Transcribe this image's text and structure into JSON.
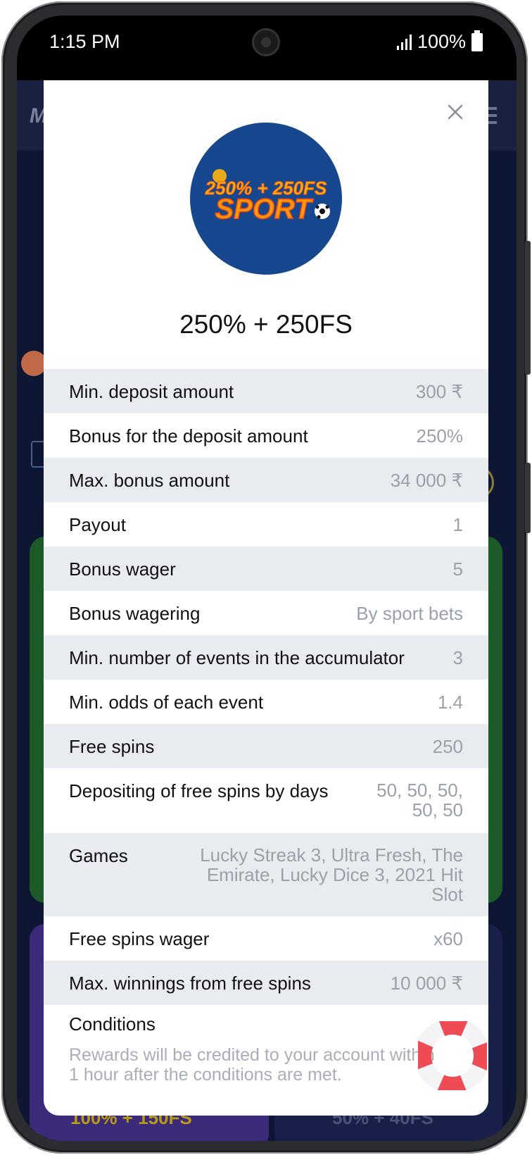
{
  "status_bar": {
    "time": "1:15 PM",
    "battery": "100%"
  },
  "background": {
    "logo_text": "M",
    "bottom_left_text": "100% + 150FS",
    "bottom_right_text": "50% + 40FS"
  },
  "modal": {
    "badge": {
      "line1": "250% + 250FS",
      "line2": "SPORT"
    },
    "title": "250% + 250FS",
    "rows": [
      {
        "label": "Min. deposit amount",
        "value": "300 ₹"
      },
      {
        "label": "Bonus for the deposit amount",
        "value": "250%"
      },
      {
        "label": "Max. bonus amount",
        "value": "34 000 ₹"
      },
      {
        "label": "Payout",
        "value": "1"
      },
      {
        "label": "Bonus wager",
        "value": "5"
      },
      {
        "label": "Bonus wagering",
        "value": "By sport bets"
      },
      {
        "label": "Min. number of events in the accumulator",
        "value": "3"
      },
      {
        "label": "Min. odds of each event",
        "value": "1.4"
      },
      {
        "label": "Free spins",
        "value": "250"
      },
      {
        "label": "Depositing of free spins by days",
        "value": "50, 50, 50, 50, 50"
      },
      {
        "label": "Games",
        "value": "Lucky Streak 3, Ultra Fresh, The Emirate, Lucky Dice 3, 2021 Hit Slot"
      },
      {
        "label": "Free spins wager",
        "value": "x60"
      },
      {
        "label": "Max. winnings from free spins",
        "value": "10 000 ₹"
      }
    ],
    "conditions": {
      "title": "Conditions",
      "text": "Rewards will be credited to your account within 1 hour after the conditions are met."
    }
  }
}
